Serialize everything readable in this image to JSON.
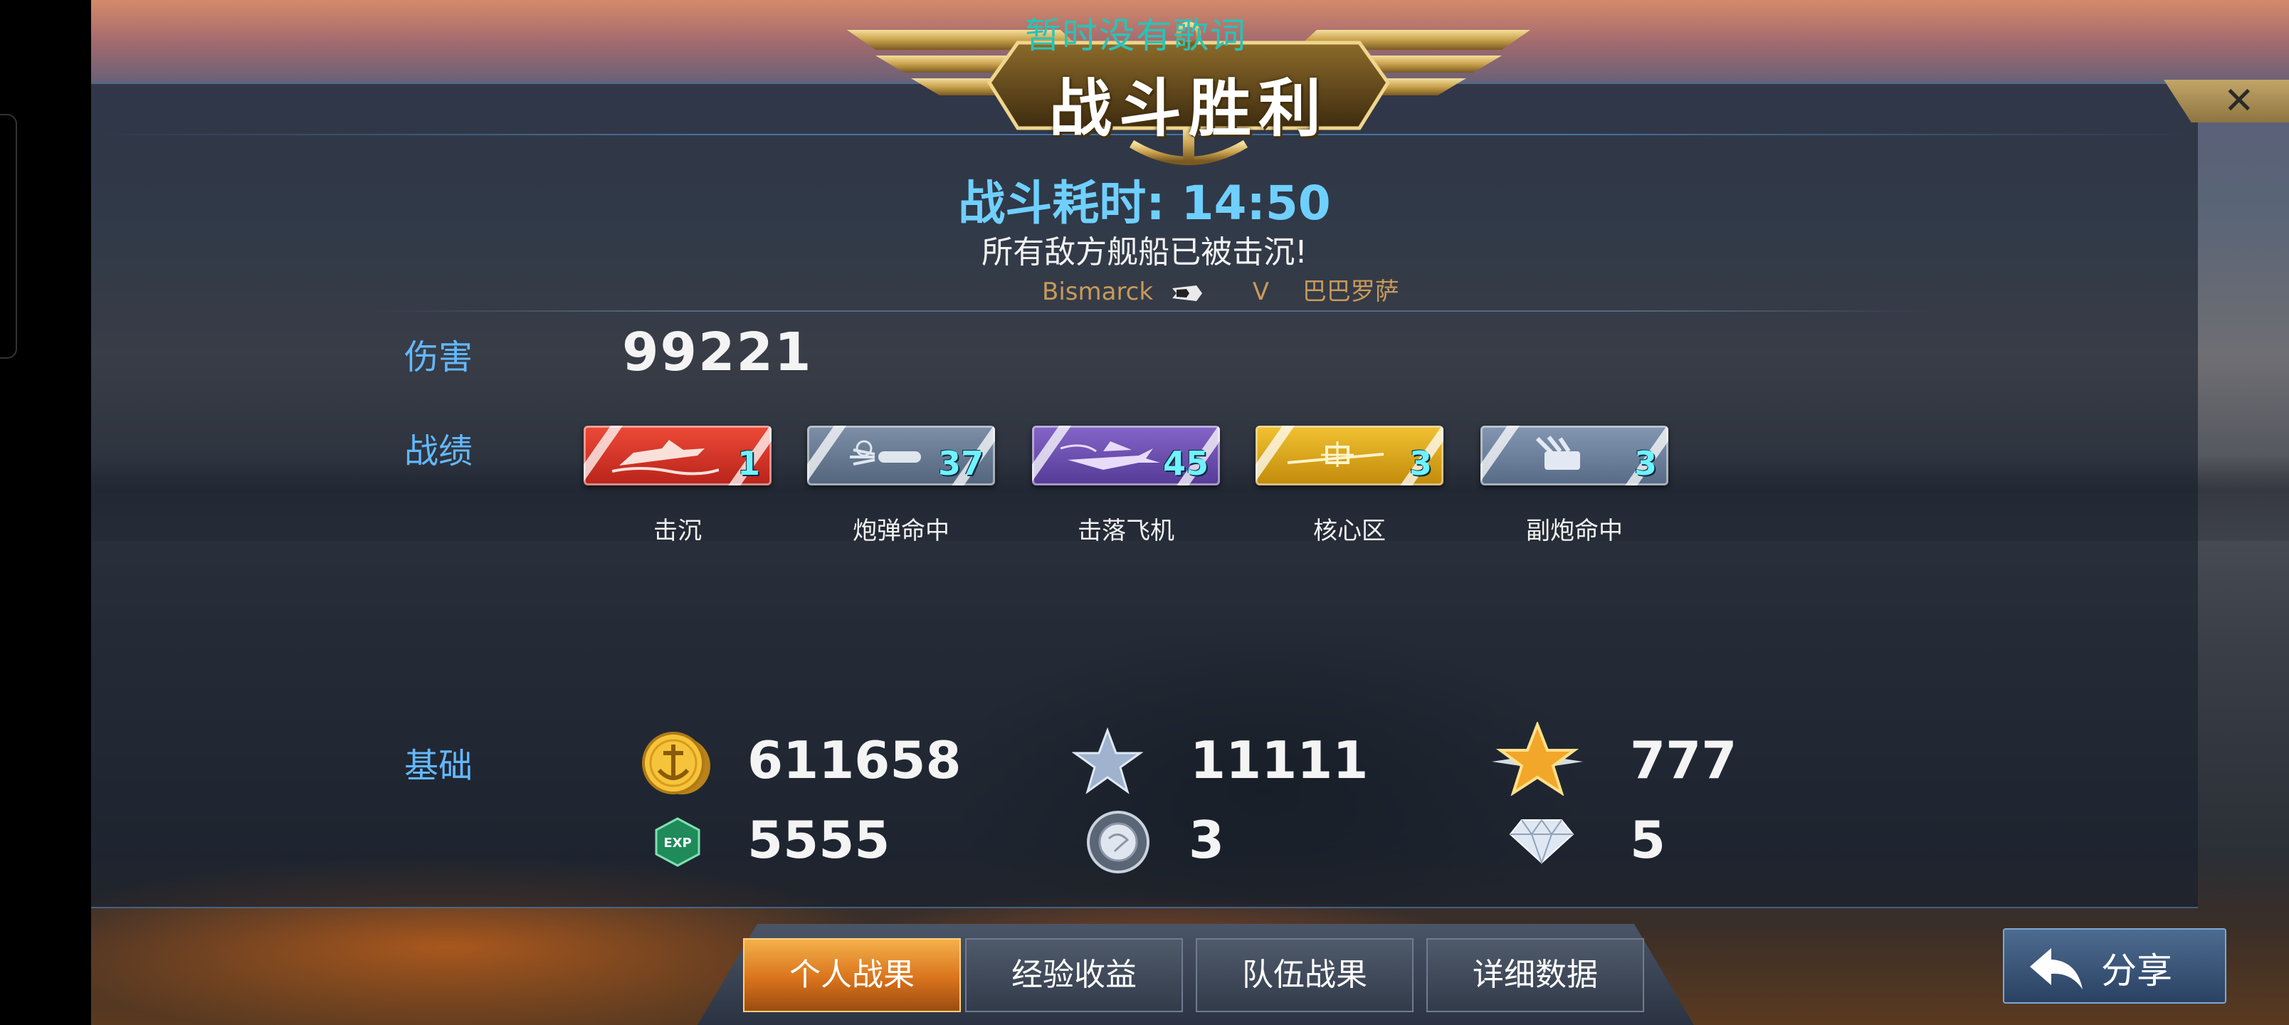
{
  "lyric_overlay": "暂时没有歌词",
  "banner": {
    "title": "战斗胜利"
  },
  "battle": {
    "time_label": "战斗耗时: 14:50",
    "result_message": "所有敌方舰船已被击沉!",
    "player_ship": "Bismarck",
    "vs": "V",
    "opponent": "巴巴罗萨"
  },
  "damage": {
    "label": "伤害",
    "value": "99221"
  },
  "record": {
    "label": "战绩",
    "badges": [
      {
        "caption": "击沉",
        "count": "1",
        "color": "#d8362a",
        "icon": "sinking-ship-icon"
      },
      {
        "caption": "炮弹命中",
        "count": "37",
        "color": "#6a7c93",
        "icon": "shell-hit-icon"
      },
      {
        "caption": "击落飞机",
        "count": "45",
        "color": "#6e4fb0",
        "icon": "plane-shotdown-icon"
      },
      {
        "caption": "核心区",
        "count": "3",
        "color": "#d4a214",
        "icon": "citadel-icon"
      },
      {
        "caption": "副炮命中",
        "count": "3",
        "color": "#6f84a0",
        "icon": "secondary-gun-icon"
      }
    ]
  },
  "base": {
    "label": "基础",
    "rewards": [
      {
        "icon": "gold-coin-icon",
        "value": "611658"
      },
      {
        "icon": "silver-star-icon",
        "value": "11111"
      },
      {
        "icon": "gold-star-icon",
        "value": "777"
      },
      {
        "icon": "exp-icon",
        "value": "5555"
      },
      {
        "icon": "globe-icon",
        "value": "3"
      },
      {
        "icon": "diamond-icon",
        "value": "5"
      }
    ]
  },
  "tabs": [
    {
      "label": "个人战果",
      "active": true
    },
    {
      "label": "经验收益",
      "active": false
    },
    {
      "label": "队伍战果",
      "active": false
    },
    {
      "label": "详细数据",
      "active": false
    }
  ],
  "share": {
    "label": "分享"
  },
  "colors": {
    "accent_blue": "#63b8ff",
    "count_cyan": "#6ff3ff",
    "tab_active": "#e88a2a"
  }
}
